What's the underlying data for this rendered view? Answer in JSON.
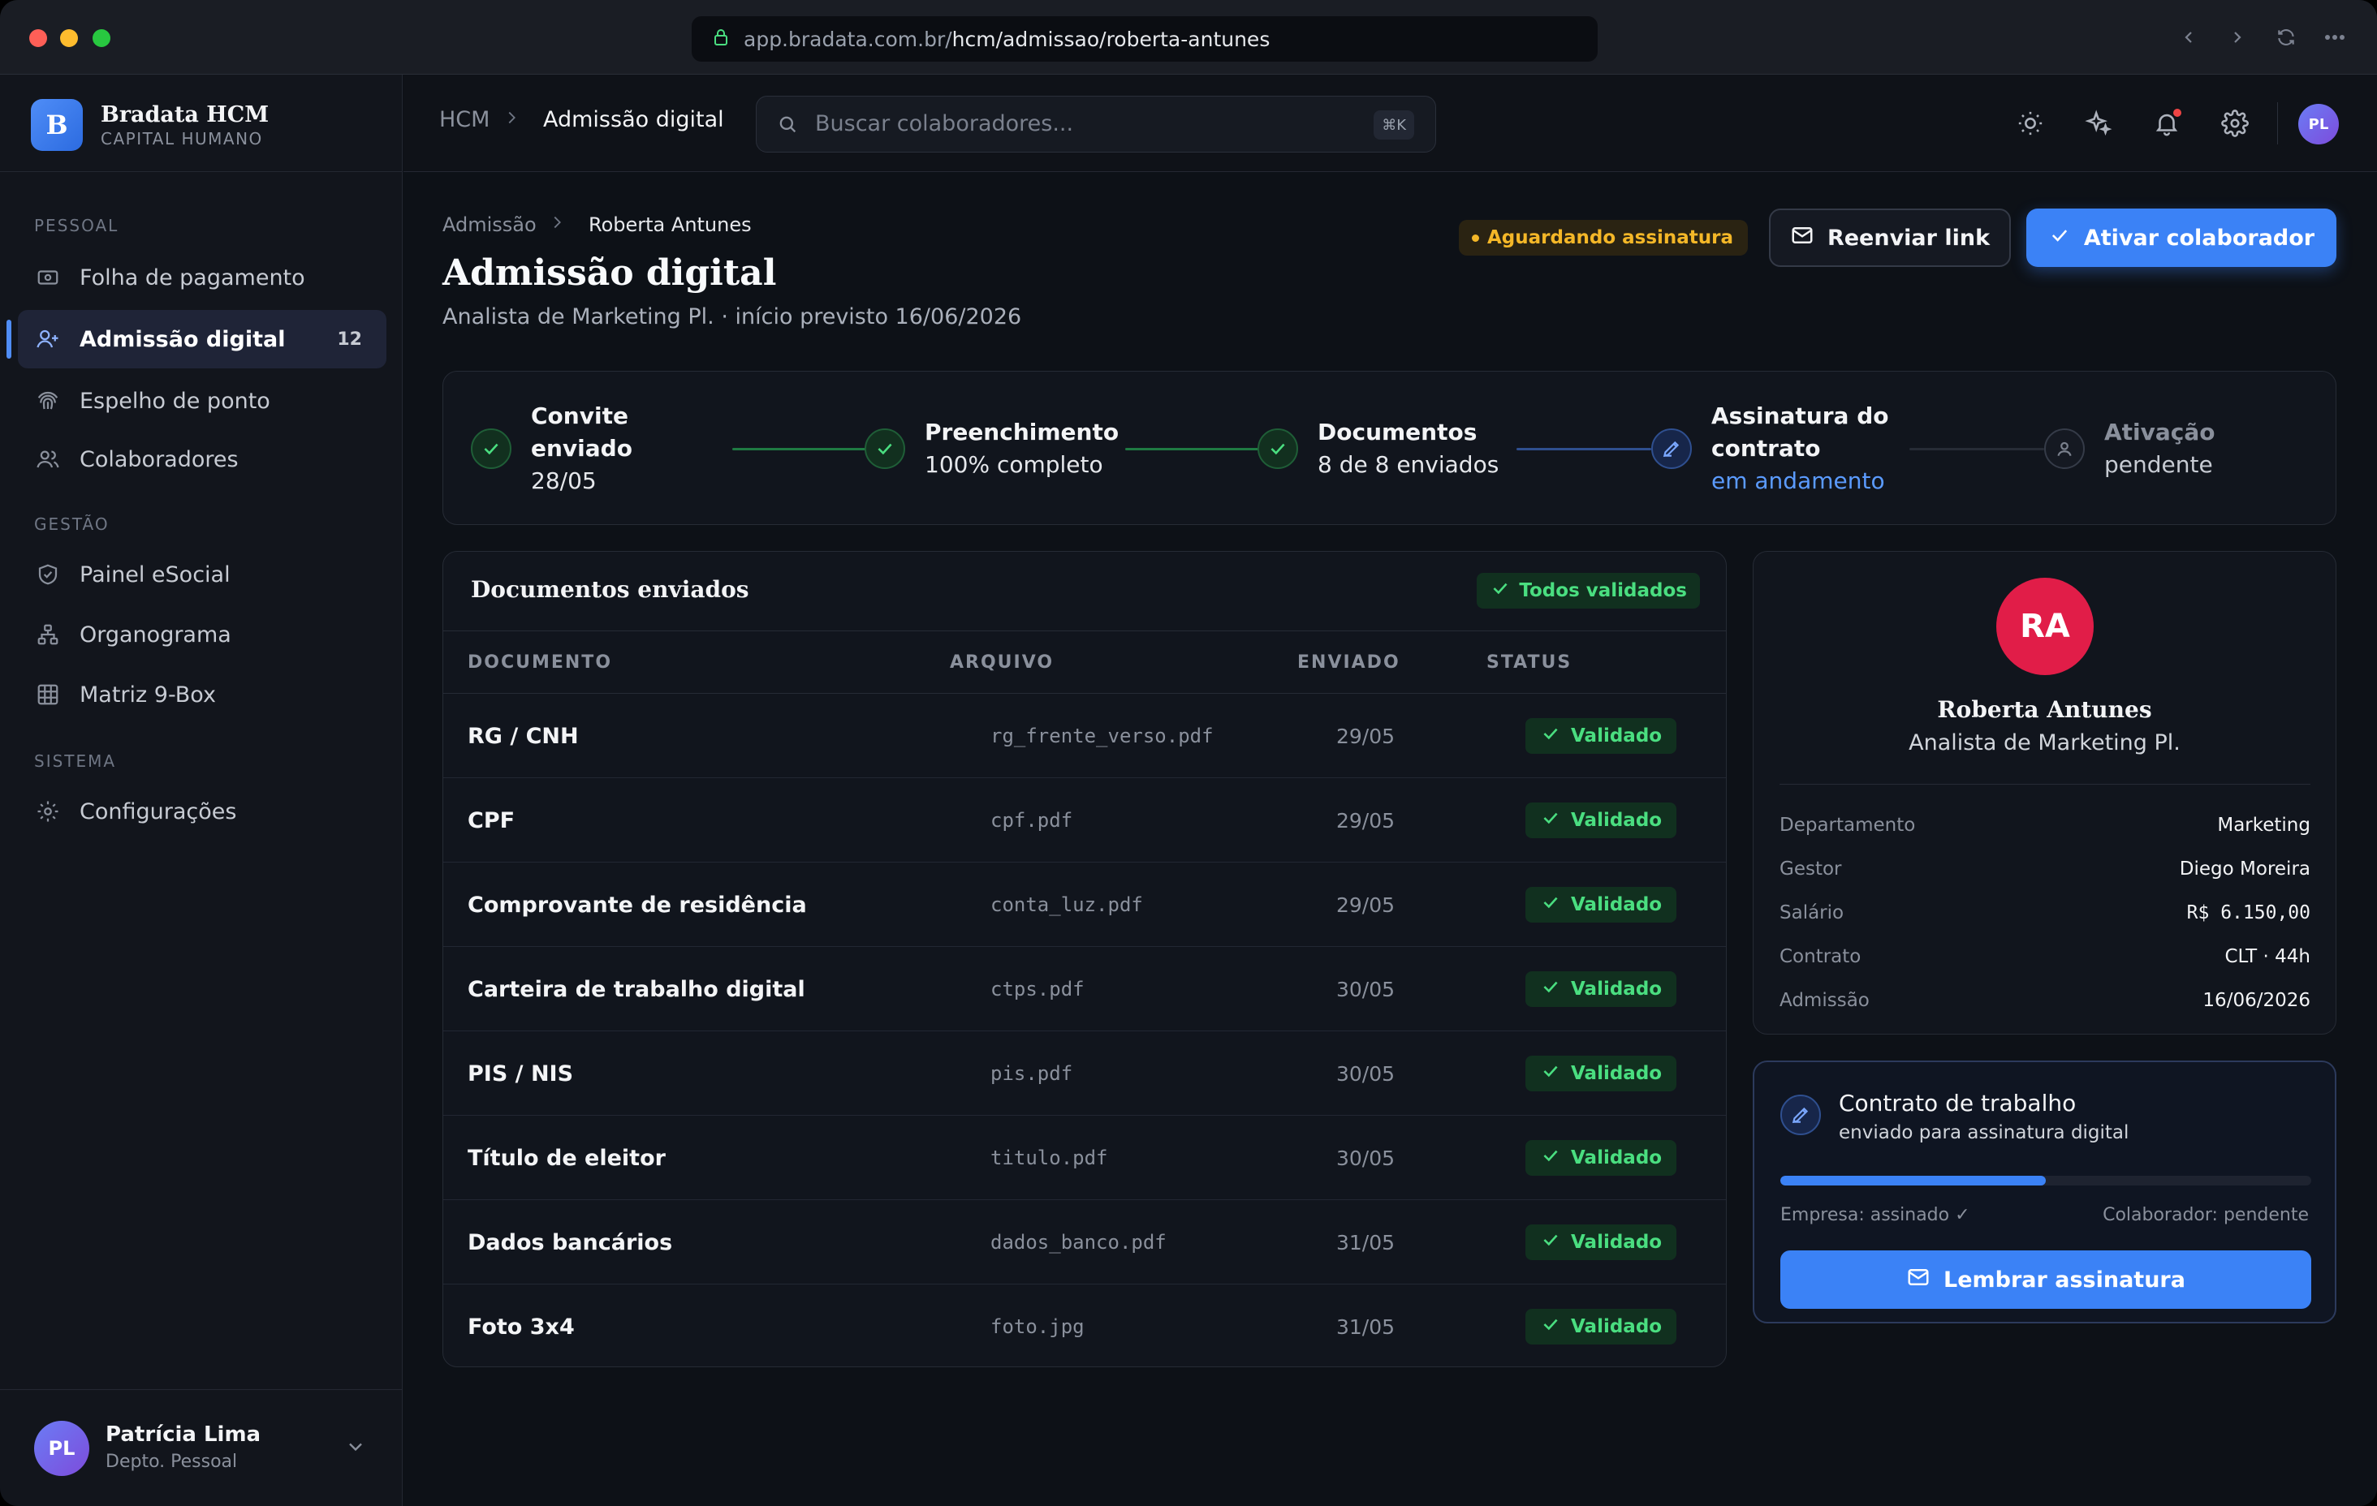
{
  "browser": {
    "url_host": "app.bradata.com.br/",
    "url_path": "hcm/admissao/roberta-antunes"
  },
  "brand": {
    "logo_letter": "B",
    "name": "Bradata HCM",
    "subtitle": "CAPITAL HUMANO"
  },
  "sidebar": {
    "sections": [
      {
        "label": "PESSOAL",
        "items": [
          {
            "label": "Folha de pagamento",
            "icon": "payroll-icon"
          },
          {
            "label": "Admissão digital",
            "icon": "user-plus-icon",
            "badge": "12",
            "active": true
          },
          {
            "label": "Espelho de ponto",
            "icon": "fingerprint-icon"
          },
          {
            "label": "Colaboradores",
            "icon": "users-icon"
          }
        ]
      },
      {
        "label": "GESTÃO",
        "items": [
          {
            "label": "Painel eSocial",
            "icon": "shield-check-icon"
          },
          {
            "label": "Organograma",
            "icon": "org-chart-icon"
          },
          {
            "label": "Matriz 9-Box",
            "icon": "grid-icon"
          }
        ]
      },
      {
        "label": "SISTEMA",
        "items": [
          {
            "label": "Configurações",
            "icon": "gear-icon"
          }
        ]
      }
    ],
    "user": {
      "initials": "PL",
      "name": "Patrícia Lima",
      "role": "Depto. Pessoal"
    }
  },
  "topbar": {
    "breadcrumb": [
      "HCM",
      "Admissão digital"
    ],
    "search_placeholder": "Buscar colaboradores...",
    "search_shortcut": "⌘K",
    "user_initials": "PL"
  },
  "page": {
    "breadcrumb": [
      "Admissão",
      "Roberta Antunes"
    ],
    "title": "Admissão digital",
    "subtitle": "Analista de Marketing Pl. · início previsto 16/06/2026",
    "status": "Aguardando assinatura",
    "resend_label": "Reenviar link",
    "activate_label": "Ativar colaborador"
  },
  "steps": [
    {
      "title": "Convite enviado",
      "sub": "28/05",
      "state": "done"
    },
    {
      "title": "Preenchimento",
      "sub": "100% completo",
      "state": "done"
    },
    {
      "title": "Documentos",
      "sub": "8 de 8 enviados",
      "state": "done"
    },
    {
      "title": "Assinatura do contrato",
      "sub": "em andamento",
      "state": "current"
    },
    {
      "title": "Ativação",
      "sub": "pendente",
      "state": "pending"
    }
  ],
  "documents": {
    "title": "Documentos enviados",
    "badge": "Todos validados",
    "columns": [
      "DOCUMENTO",
      "ARQUIVO",
      "ENVIADO",
      "STATUS"
    ],
    "rows": [
      {
        "doc": "RG / CNH",
        "file": "rg_frente_verso.pdf",
        "date": "29/05",
        "status": "Validado"
      },
      {
        "doc": "CPF",
        "file": "cpf.pdf",
        "date": "29/05",
        "status": "Validado"
      },
      {
        "doc": "Comprovante de residência",
        "file": "conta_luz.pdf",
        "date": "29/05",
        "status": "Validado"
      },
      {
        "doc": "Carteira de trabalho digital",
        "file": "ctps.pdf",
        "date": "30/05",
        "status": "Validado"
      },
      {
        "doc": "PIS / NIS",
        "file": "pis.pdf",
        "date": "30/05",
        "status": "Validado"
      },
      {
        "doc": "Título de eleitor",
        "file": "titulo.pdf",
        "date": "30/05",
        "status": "Validado"
      },
      {
        "doc": "Dados bancários",
        "file": "dados_banco.pdf",
        "date": "31/05",
        "status": "Validado"
      },
      {
        "doc": "Foto 3x4",
        "file": "foto.jpg",
        "date": "31/05",
        "status": "Validado"
      }
    ]
  },
  "profile": {
    "initials": "RA",
    "name": "Roberta Antunes",
    "role": "Analista de Marketing Pl.",
    "fields": [
      {
        "k": "Departamento",
        "v": "Marketing"
      },
      {
        "k": "Gestor",
        "v": "Diego Moreira"
      },
      {
        "k": "Salário",
        "v": "R$ 6.150,00"
      },
      {
        "k": "Contrato",
        "v": "CLT · 44h"
      },
      {
        "k": "Admissão",
        "v": "16/06/2026"
      }
    ]
  },
  "contract": {
    "title": "Contrato de trabalho",
    "sub": "enviado para assinatura digital",
    "progress": 0.5,
    "left_status": "Empresa: assinado ✓",
    "right_status": "Colaborador: pendente",
    "button": "Lembrar assinatura"
  },
  "colors": {
    "accent": "#3b82f6",
    "success": "#4ade80",
    "warning": "#f4b728",
    "avatar": "#e11d48"
  }
}
